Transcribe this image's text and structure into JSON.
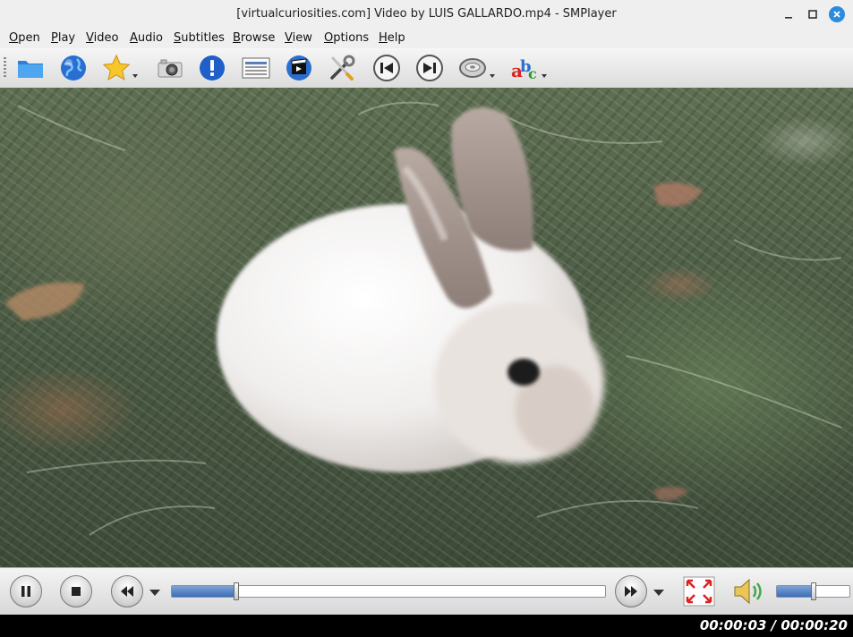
{
  "window": {
    "title": "[virtualcuriosities.com] Video by LUIS GALLARDO.mp4 - SMPlayer",
    "controls": [
      "minimize-icon",
      "maximize-icon",
      "close-icon"
    ]
  },
  "menubar": {
    "items": [
      {
        "mnemonic": "O",
        "rest": "pen"
      },
      {
        "mnemonic": "P",
        "rest": "lay"
      },
      {
        "mnemonic": "V",
        "rest": "ideo"
      },
      {
        "mnemonic": "A",
        "rest": "udio"
      },
      {
        "mnemonic": "S",
        "rest": "ubtitles"
      },
      {
        "mnemonic": "B",
        "rest": "rowse"
      },
      {
        "mnemonic": "V",
        "rest": "iew"
      },
      {
        "mnemonic": "O",
        "rest": "ptions"
      },
      {
        "mnemonic": "H",
        "rest": "elp"
      }
    ]
  },
  "toolbar": {
    "buttons": [
      {
        "icon": "folder-icon",
        "dropdown": false
      },
      {
        "icon": "globe-icon",
        "dropdown": false
      },
      {
        "icon": "star-icon",
        "dropdown": true
      },
      {
        "icon": "camera-icon",
        "dropdown": false
      },
      {
        "icon": "info-icon",
        "dropdown": false
      },
      {
        "icon": "playlist-icon",
        "dropdown": false
      },
      {
        "icon": "video-equalizer-icon",
        "dropdown": false
      },
      {
        "icon": "preferences-tools-icon",
        "dropdown": false
      },
      {
        "icon": "previous-icon",
        "dropdown": false
      },
      {
        "icon": "next-icon",
        "dropdown": false
      },
      {
        "icon": "audio-track-icon",
        "dropdown": true
      },
      {
        "icon": "subtitles-abc-icon",
        "dropdown": true
      }
    ]
  },
  "video": {
    "content": "rabbit-on-grass"
  },
  "controls": {
    "play_pause_icon": "pause-icon",
    "stop_icon": "stop-icon",
    "rewind_icon": "rewind-icon",
    "forward_icon": "forward-icon",
    "fullscreen_icon": "fullscreen-icon",
    "mute_icon": "speaker-icon",
    "seek_progress": 0.15,
    "volume_level": 0.5
  },
  "status": {
    "time": "00:00:03 / 00:00:20"
  },
  "colors": {
    "accent": "#2a8cdc",
    "progress": "#3c6fb4",
    "status_bg": "#000000"
  }
}
